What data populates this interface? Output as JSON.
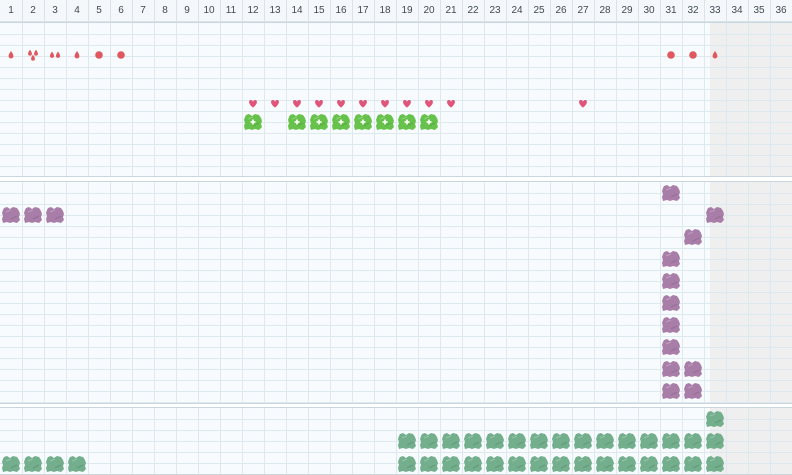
{
  "columns": [
    "1",
    "2",
    "3",
    "4",
    "5",
    "6",
    "7",
    "8",
    "9",
    "10",
    "11",
    "12",
    "13",
    "14",
    "15",
    "16",
    "17",
    "18",
    "19",
    "20",
    "21",
    "22",
    "23",
    "24",
    "25",
    "26",
    "27",
    "28",
    "29",
    "30",
    "31",
    "32",
    "33",
    "34",
    "35",
    "36"
  ],
  "shaded_from_column": 33,
  "colors": {
    "grid_line": "#dde8ef",
    "panel_bg": "#f7fbfd",
    "shade_bg": "#efefef",
    "red_marker": "#e0585f",
    "pink_heart": "#e0557a",
    "green_block": "#67c24c",
    "purple_block": "#a87ea8",
    "teal_block": "#73ae8d"
  },
  "icons": [
    "drop-icon",
    "dot-icon",
    "heart-icon",
    "plus-icon",
    "block-icon"
  ],
  "rows": {
    "drops": [
      {
        "col": 1,
        "kind": "drop"
      },
      {
        "col": 2,
        "kind": "drop-cluster"
      },
      {
        "col": 3,
        "kind": "drop-pair"
      },
      {
        "col": 4,
        "kind": "drop"
      },
      {
        "col": 5,
        "kind": "dot"
      },
      {
        "col": 6,
        "kind": "dot"
      },
      {
        "col": 31,
        "kind": "dot"
      },
      {
        "col": 32,
        "kind": "dot"
      },
      {
        "col": 33,
        "kind": "drop"
      }
    ],
    "hearts": [
      12,
      13,
      14,
      15,
      16,
      17,
      18,
      19,
      20,
      21,
      27
    ],
    "plus_blocks": [
      12,
      14,
      15,
      16,
      17,
      18,
      19,
      20
    ],
    "purple_blocks": [
      {
        "col": 1,
        "row": 2
      },
      {
        "col": 2,
        "row": 2
      },
      {
        "col": 3,
        "row": 2
      },
      {
        "col": 31,
        "row": 1
      },
      {
        "col": 33,
        "row": 2
      },
      {
        "col": 32,
        "row": 3
      },
      {
        "col": 31,
        "row": 4
      },
      {
        "col": 31,
        "row": 5
      },
      {
        "col": 31,
        "row": 6
      },
      {
        "col": 31,
        "row": 7
      },
      {
        "col": 31,
        "row": 8
      },
      {
        "col": 31,
        "row": 9
      },
      {
        "col": 32,
        "row": 9
      },
      {
        "col": 31,
        "row": 10
      },
      {
        "col": 32,
        "row": 10
      }
    ],
    "teal_blocks": {
      "top": [
        33
      ],
      "middle": [
        19,
        20,
        21,
        22,
        23,
        24,
        25,
        26,
        27,
        28,
        29,
        30,
        31,
        32,
        33
      ],
      "bottom": [
        1,
        2,
        3,
        4,
        19,
        20,
        21,
        22,
        23,
        24,
        25,
        26,
        27,
        28,
        29,
        30,
        31,
        32,
        33
      ]
    }
  }
}
